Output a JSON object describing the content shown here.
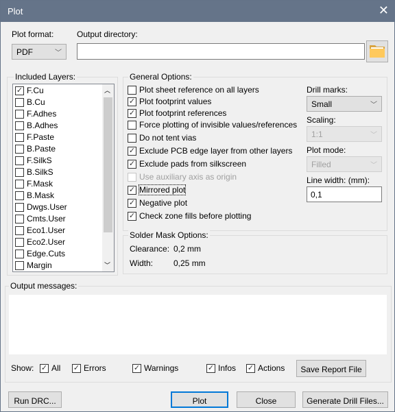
{
  "window": {
    "title": "Plot",
    "close_icon": "close-icon"
  },
  "plot_format": {
    "label": "Plot format:",
    "value": "PDF"
  },
  "output_directory": {
    "label": "Output directory:",
    "value": "",
    "browse_icon": "folder-icon"
  },
  "layers": {
    "label": "Included Layers:",
    "items": [
      {
        "name": "F.Cu",
        "checked": true
      },
      {
        "name": "B.Cu",
        "checked": false
      },
      {
        "name": "F.Adhes",
        "checked": false
      },
      {
        "name": "B.Adhes",
        "checked": false
      },
      {
        "name": "F.Paste",
        "checked": false
      },
      {
        "name": "B.Paste",
        "checked": false
      },
      {
        "name": "F.SilkS",
        "checked": false
      },
      {
        "name": "B.SilkS",
        "checked": false
      },
      {
        "name": "F.Mask",
        "checked": false
      },
      {
        "name": "B.Mask",
        "checked": false
      },
      {
        "name": "Dwgs.User",
        "checked": false
      },
      {
        "name": "Cmts.User",
        "checked": false
      },
      {
        "name": "Eco1.User",
        "checked": false
      },
      {
        "name": "Eco2.User",
        "checked": false
      },
      {
        "name": "Edge.Cuts",
        "checked": false
      },
      {
        "name": "Margin",
        "checked": false
      }
    ]
  },
  "general": {
    "label": "General Options:",
    "options": [
      {
        "label": "Plot sheet reference on all layers",
        "checked": false
      },
      {
        "label": "Plot footprint values",
        "checked": true
      },
      {
        "label": "Plot footprint references",
        "checked": true
      },
      {
        "label": "Force plotting of invisible values/references",
        "checked": false
      },
      {
        "label": "Do not tent vias",
        "checked": false
      },
      {
        "label": "Exclude PCB edge layer from other layers",
        "checked": true
      },
      {
        "label": "Exclude pads from silkscreen",
        "checked": true
      },
      {
        "label": "Use auxiliary axis as origin",
        "checked": false,
        "disabled": true
      },
      {
        "label": "Mirrored plot",
        "checked": true,
        "focused": true
      },
      {
        "label": "Negative plot",
        "checked": true
      },
      {
        "label": "Check zone fills before plotting",
        "checked": true
      }
    ],
    "drill_marks": {
      "label": "Drill marks:",
      "value": "Small"
    },
    "scaling": {
      "label": "Scaling:",
      "value": "1:1"
    },
    "plot_mode": {
      "label": "Plot mode:",
      "value": "Filled"
    },
    "line_width": {
      "label": "Line width: (mm):",
      "value": "0,1"
    }
  },
  "solder_mask": {
    "label": "Solder Mask Options:",
    "clearance_label": "Clearance:",
    "clearance": "0,2 mm",
    "width_label": "Width:",
    "width": "0,25 mm"
  },
  "messages": {
    "label": "Output messages:",
    "show_label": "Show:",
    "filters": [
      {
        "label": "All",
        "checked": true
      },
      {
        "label": "Errors",
        "checked": true
      },
      {
        "label": "Warnings",
        "checked": true
      },
      {
        "label": "Infos",
        "checked": true
      },
      {
        "label": "Actions",
        "checked": true
      }
    ],
    "save_report": "Save Report File"
  },
  "buttons": {
    "run_drc": "Run DRC...",
    "plot": "Plot",
    "close": "Close",
    "generate_drill": "Generate Drill Files..."
  }
}
